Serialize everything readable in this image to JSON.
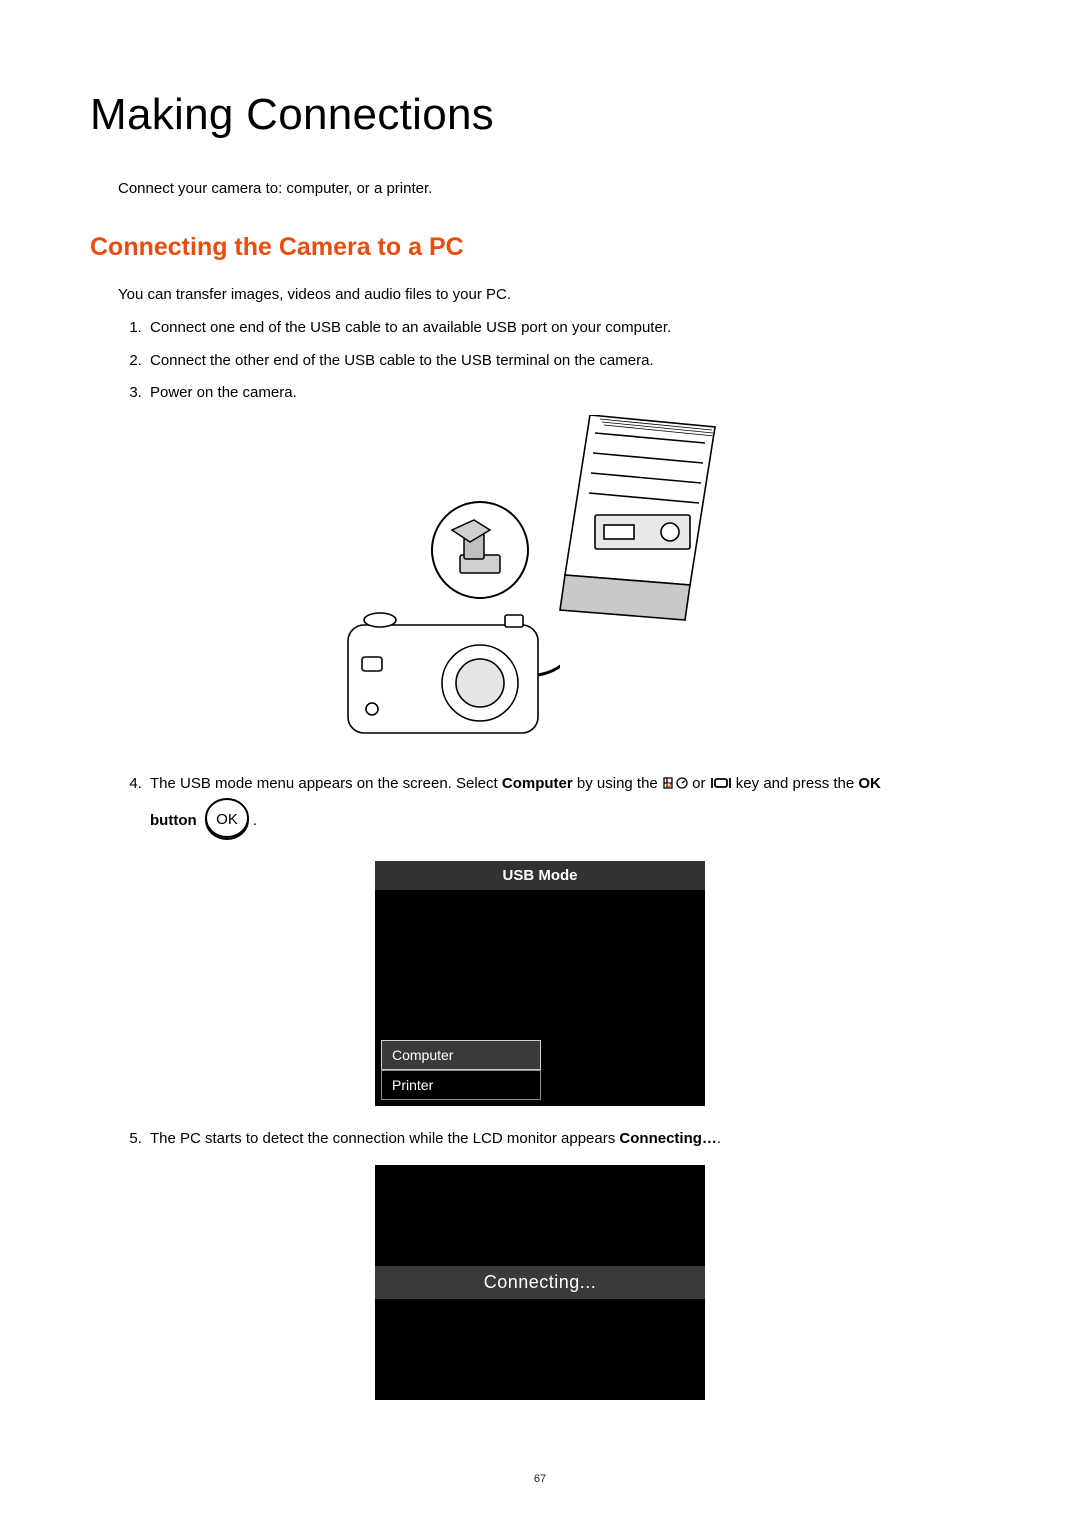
{
  "title": "Making Connections",
  "intro": "Connect your camera to: computer, or a printer.",
  "section_heading": "Connecting the Camera to a PC",
  "lead": "You can transfer images, videos and audio files to your PC.",
  "steps": {
    "s1": "Connect one end of the USB cable to an available USB port on your computer.",
    "s2": "Connect the other end of the USB cable to the USB terminal on the camera.",
    "s3": "Power on the camera.",
    "s4_pre": "The USB mode menu appears on the screen. Select ",
    "s4_bold1": "Computer",
    "s4_mid1": " by using the ",
    "s4_mid2": " or ",
    "s4_mid3": " key and press the ",
    "s4_bold2": "OK",
    "s4_button": "button",
    "s4_end": ".",
    "s5_pre": "The PC starts to detect the connection while the LCD monitor appears ",
    "s5_bold": "Connecting…",
    "s5_end": "."
  },
  "usb_mode": {
    "title": "USB Mode",
    "opt1": "Computer",
    "opt2": "Printer"
  },
  "connecting_label": "Connecting...",
  "ok_label": "OK",
  "page_number": "67"
}
